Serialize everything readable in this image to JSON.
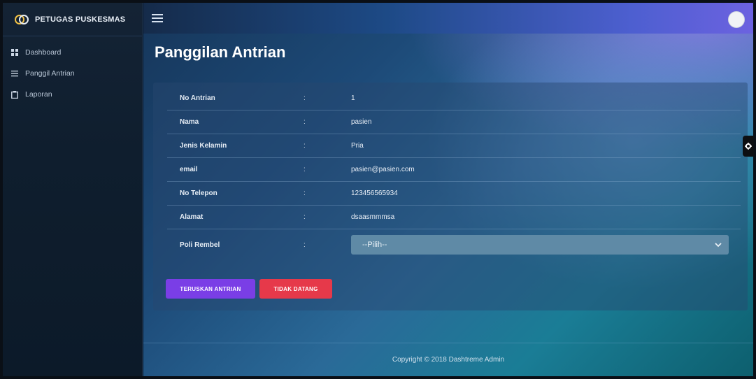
{
  "brand": {
    "name": "PETUGAS PUSKESMAS"
  },
  "sidebar": {
    "items": [
      {
        "label": "Dashboard",
        "icon": "grid-icon"
      },
      {
        "label": "Panggil Antrian",
        "icon": "list-icon"
      },
      {
        "label": "Laporan",
        "icon": "clipboard-icon"
      }
    ]
  },
  "page": {
    "title": "Panggilan Antrian"
  },
  "patient": {
    "rows": [
      {
        "label": "No Antrian",
        "sep": ":",
        "value": "1"
      },
      {
        "label": "Nama",
        "sep": ":",
        "value": "pasien"
      },
      {
        "label": "Jenis Kelamin",
        "sep": ":",
        "value": "Pria"
      },
      {
        "label": "email",
        "sep": ":",
        "value": "pasien@pasien.com"
      },
      {
        "label": "No Telepon",
        "sep": ":",
        "value": "123456565934"
      },
      {
        "label": "Alamat",
        "sep": ":",
        "value": "dsaasmmmsa"
      },
      {
        "label": "Poli Rembel",
        "sep": ":"
      }
    ],
    "poli_select": {
      "selected": "--Pilih--"
    }
  },
  "actions": {
    "accept_label": "TERUSKAN ANTRIAN",
    "absent_label": "TIDAK DATANG"
  },
  "footer": {
    "copyright": "Copyright © 2018 Dashtreme Admin"
  },
  "colors": {
    "accept_button": "#7a3ee6",
    "absent_button": "#e6394a",
    "select_bg": "#5f8aa6"
  }
}
